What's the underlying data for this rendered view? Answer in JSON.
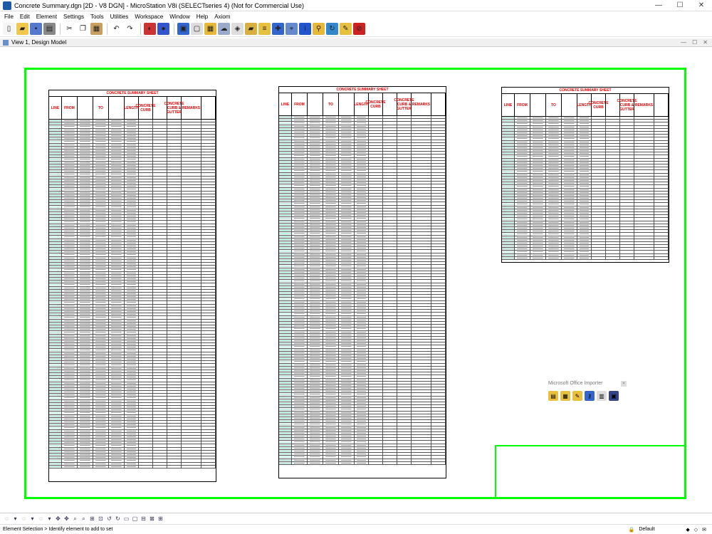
{
  "window": {
    "title": "Concrete Summary.dgn [2D - V8 DGN] - MicroStation V8i (SELECTseries 4) (Not for Commercial Use)",
    "minimize": "—",
    "maximize": "☐",
    "close": "✕"
  },
  "menu": [
    "File",
    "Edit",
    "Element",
    "Settings",
    "Tools",
    "Utilities",
    "Workspace",
    "Window",
    "Help",
    "Axiom"
  ],
  "toolbar": {
    "buttons": [
      {
        "icon": "new-file-icon",
        "glyph": "▯",
        "color": "#f5f5f5"
      },
      {
        "icon": "open-folder-icon",
        "glyph": "▰",
        "color": "#f1c84c"
      },
      {
        "icon": "save-icon",
        "glyph": "▪",
        "color": "#5577cc"
      },
      {
        "icon": "print-icon",
        "glyph": "▤",
        "color": "#888888"
      },
      {
        "icon": "cut-icon",
        "glyph": "✂",
        "color": "#ffffff"
      },
      {
        "icon": "copy-icon",
        "glyph": "❐",
        "color": "#ffffff"
      },
      {
        "icon": "paste-icon",
        "glyph": "▦",
        "color": "#c9a060"
      },
      {
        "icon": "undo-icon",
        "glyph": "↶",
        "color": "#ffffff"
      },
      {
        "icon": "redo-icon",
        "glyph": "↷",
        "color": "#ffffff"
      },
      {
        "icon": "render-icon",
        "glyph": "◐",
        "color": "#cc3333"
      },
      {
        "icon": "globe-icon",
        "glyph": "●",
        "color": "#3355cc"
      },
      {
        "icon": "view-icon",
        "glyph": "▣",
        "color": "#3366cc"
      },
      {
        "icon": "document-icon",
        "glyph": "▢",
        "color": "#dddddd"
      },
      {
        "icon": "table-icon",
        "glyph": "▦",
        "color": "#e8b838"
      },
      {
        "icon": "cloud-icon",
        "glyph": "☁",
        "color": "#99aacc"
      },
      {
        "icon": "layer-icon",
        "glyph": "◈",
        "color": "#dddddd"
      },
      {
        "icon": "folder-tools-icon",
        "glyph": "▰",
        "color": "#d8b040"
      },
      {
        "icon": "stack-icon",
        "glyph": "≡",
        "color": "#e8c040"
      },
      {
        "icon": "measure-icon",
        "glyph": "✚",
        "color": "#3366cc"
      },
      {
        "icon": "snap-icon",
        "glyph": "⌖",
        "color": "#6688cc"
      },
      {
        "icon": "info-icon",
        "glyph": "i",
        "color": "#2255cc"
      },
      {
        "icon": "zoom-icon",
        "glyph": "⚲",
        "color": "#e8b838"
      },
      {
        "icon": "refresh-icon",
        "glyph": "↻",
        "color": "#3388cc"
      },
      {
        "icon": "pencil-icon",
        "glyph": "✎",
        "color": "#e8c040"
      },
      {
        "icon": "no-symbol-icon",
        "glyph": "⊘",
        "color": "#cc2222"
      }
    ]
  },
  "view": {
    "title": "View 1, Design Model",
    "controls": [
      "—",
      "☐",
      "✕"
    ]
  },
  "sheets": [
    {
      "title": "CONCRETE SUMMARY SHEET",
      "rows": 117
    },
    {
      "title": "CONCRETE SUMMARY SHEET",
      "rows": 117
    },
    {
      "title": "CONCRETE SUMMARY SHEET",
      "rows": 48
    }
  ],
  "sheet_headers": {
    "line": "LINE",
    "from": "FROM",
    "to": "TO",
    "length": "LENGTH",
    "curb": "CONCRETE CURB",
    "curb_gutter": "CONCRETE CURB & GUTTER",
    "remarks": "REMARKS",
    "type_b4": "TYPE B4",
    "type_m2": "TYPE M2",
    "type_b1": "TYPE B1",
    "station": "STATION",
    "offset": "OFFSET",
    "feet": "FEET"
  },
  "importer": {
    "title": "Microsoft Office Importer",
    "close": "×",
    "tools": [
      {
        "icon": "import-word-icon",
        "glyph": "▤",
        "color": "#e8c040"
      },
      {
        "icon": "import-excel-icon",
        "glyph": "▦",
        "color": "#e8c040"
      },
      {
        "icon": "import-edit-icon",
        "glyph": "✎",
        "color": "#e8c040"
      },
      {
        "icon": "import-link-icon",
        "glyph": "⚷",
        "color": "#3366cc"
      },
      {
        "icon": "import-compare-icon",
        "glyph": "▥",
        "color": "#dddddd"
      },
      {
        "icon": "import-table-icon",
        "glyph": "▣",
        "color": "#334488"
      }
    ]
  },
  "bottom_toolbar": [
    "◌",
    "▾",
    "◌",
    "▾",
    "◌",
    "▾",
    "✥",
    "✥",
    "⌕",
    "⌕",
    "⊞",
    "⊡",
    "↺",
    "↻",
    "▭",
    "▢",
    "⊟",
    "⊠",
    "⊞"
  ],
  "status": {
    "message": "Element Selection > Identify element to add to set",
    "level": "Default"
  }
}
